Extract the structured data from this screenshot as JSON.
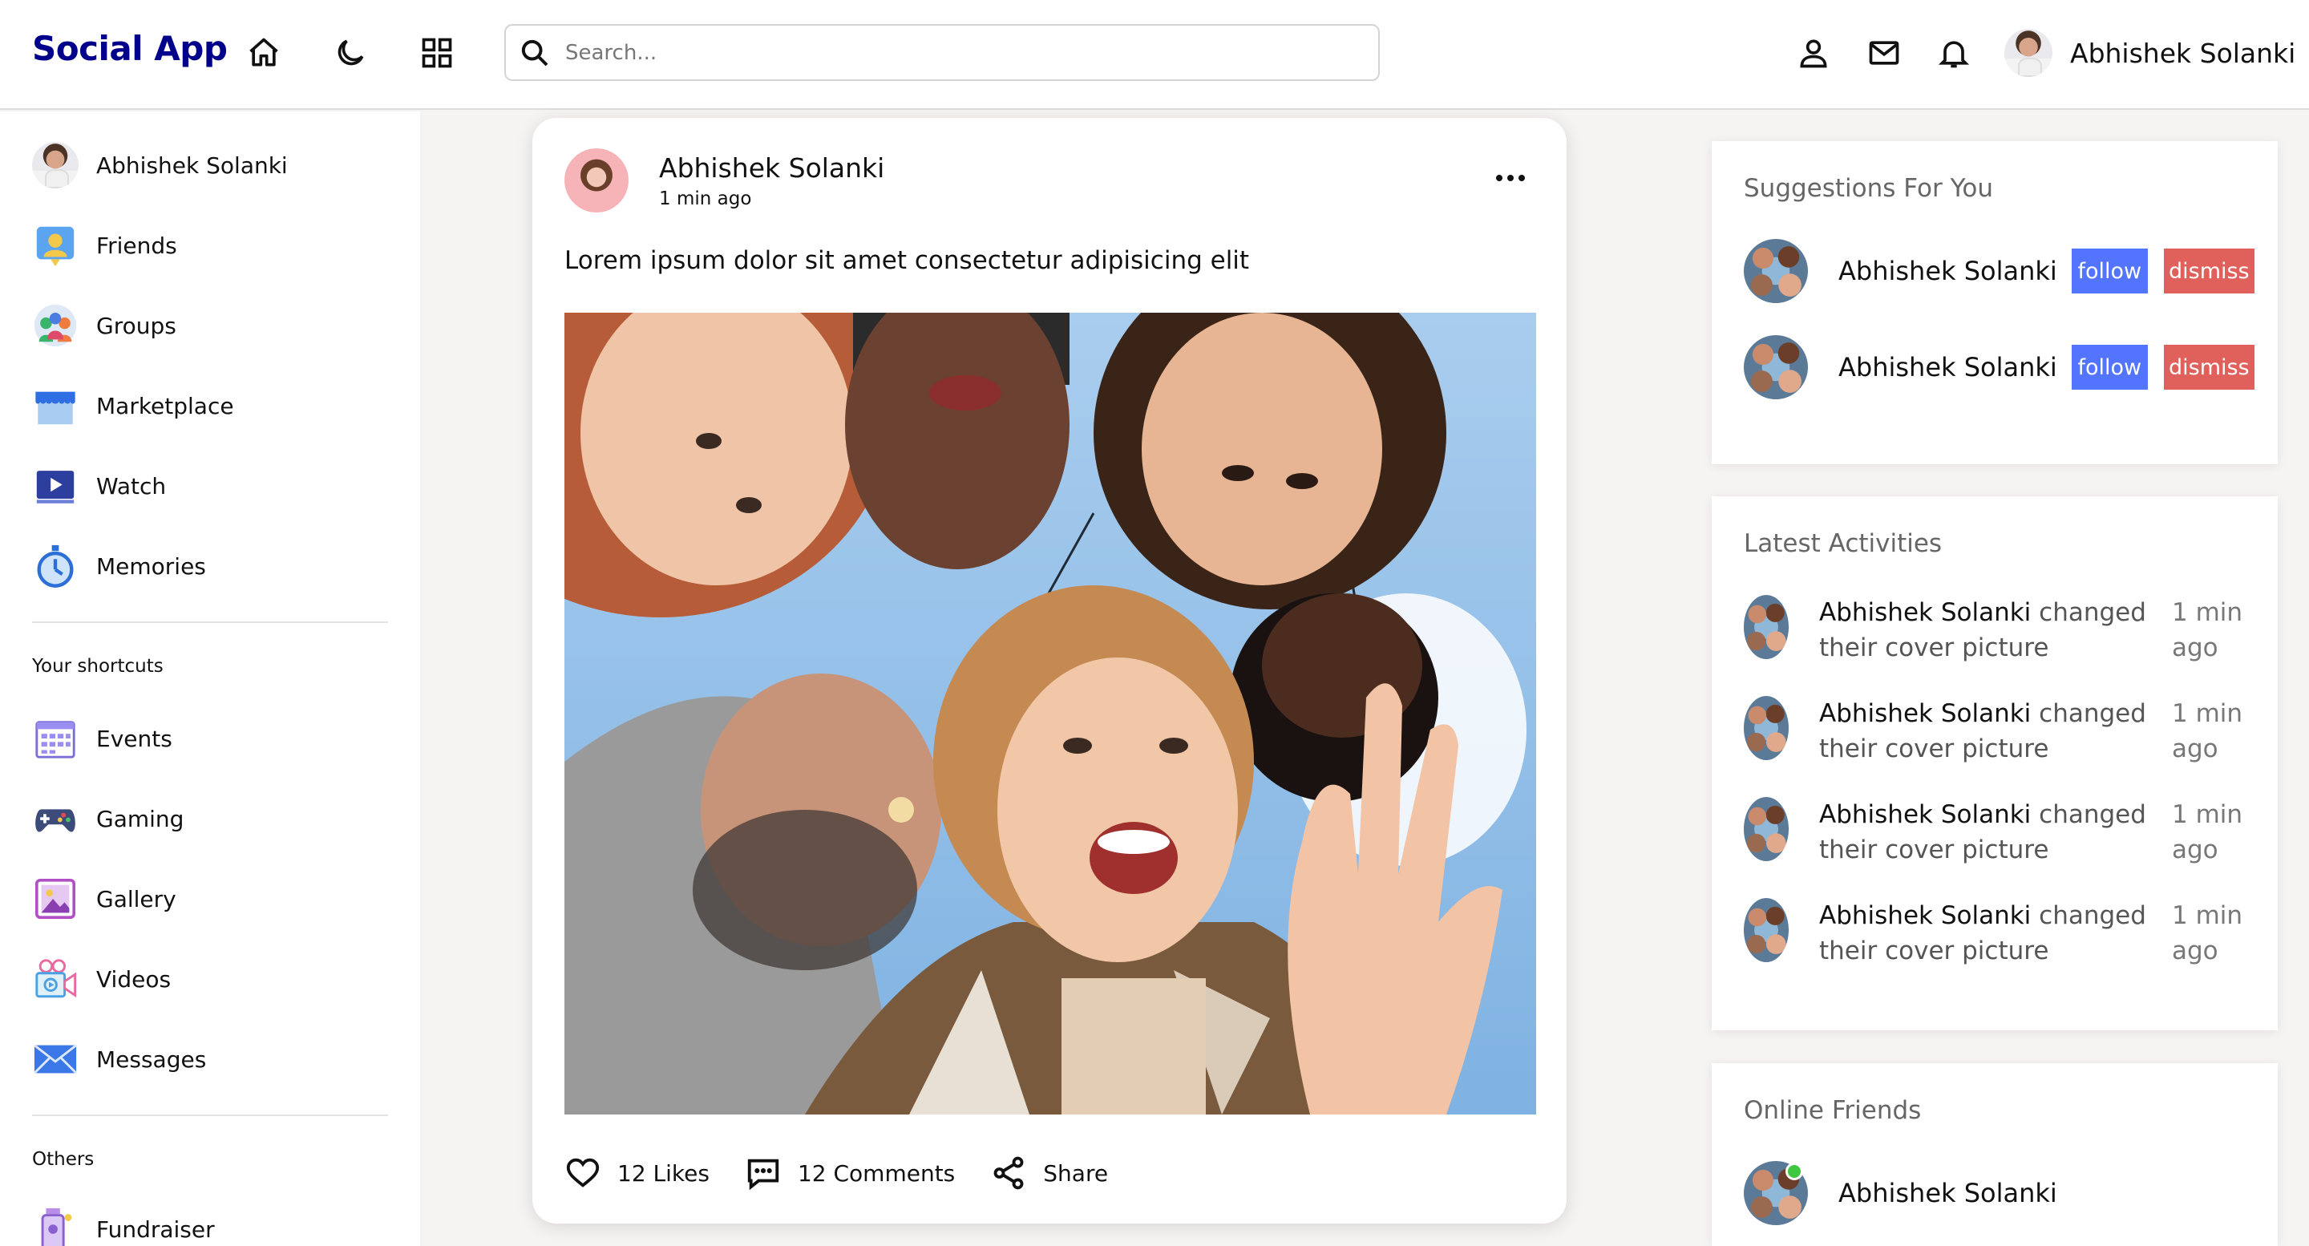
{
  "nav": {
    "logo": "Social App",
    "search_placeholder": "Search...",
    "user_name": "Abhishek Solanki"
  },
  "sidebar": {
    "profile_name": "Abhishek Solanki",
    "menu": [
      "Friends",
      "Groups",
      "Marketplace",
      "Watch",
      "Memories"
    ],
    "shortcuts_heading": "Your shortcuts",
    "shortcuts": [
      "Events",
      "Gaming",
      "Gallery",
      "Videos",
      "Messages"
    ],
    "others_heading": "Others",
    "others": [
      "Fundraiser"
    ]
  },
  "post": {
    "author": "Abhishek Solanki",
    "time": "1 min ago",
    "text": "Lorem ipsum dolor sit amet consectetur adipisicing elit",
    "likes": "12 Likes",
    "comments": "12 Comments",
    "share": "Share"
  },
  "suggestions": {
    "title": "Suggestions For You",
    "items": [
      {
        "name": "Abhishek Solanki",
        "follow": "follow",
        "dismiss": "dismiss"
      },
      {
        "name": "Abhishek Solanki",
        "follow": "follow",
        "dismiss": "dismiss"
      }
    ]
  },
  "activities": {
    "title": "Latest Activities",
    "items": [
      {
        "name": "Abhishek Solanki",
        "action": "changed their cover picture",
        "time": "1 min ago"
      },
      {
        "name": "Abhishek Solanki",
        "action": "changed their cover picture",
        "time": "1 min ago"
      },
      {
        "name": "Abhishek Solanki",
        "action": "changed their cover picture",
        "time": "1 min ago"
      },
      {
        "name": "Abhishek Solanki",
        "action": "changed their cover picture",
        "time": "1 min ago"
      }
    ]
  },
  "online": {
    "title": "Online Friends",
    "items": [
      {
        "name": "Abhishek Solanki"
      }
    ]
  },
  "colors": {
    "brand": "#00008b",
    "follow": "#5274ff",
    "dismiss": "#e0605c",
    "online": "#3fc73f"
  }
}
